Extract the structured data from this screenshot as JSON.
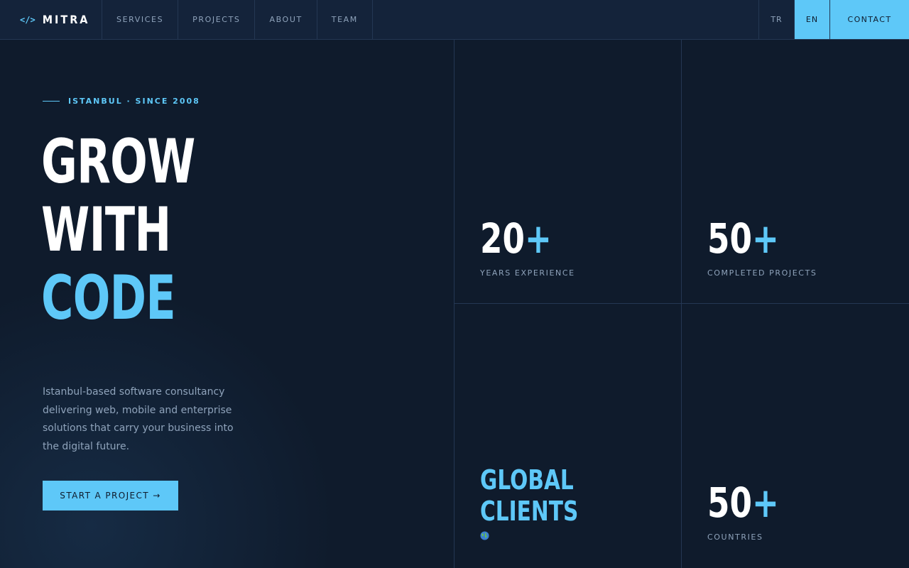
{
  "nav": {
    "brand_icon": "</>",
    "brand": "MITRA",
    "links": [
      "SERVICES",
      "PROJECTS",
      "ABOUT",
      "TEAM"
    ],
    "langs": [
      "TR",
      "EN"
    ],
    "active_lang": "EN",
    "contact": "CONTACT"
  },
  "hero": {
    "eyebrow": "ISTANBUL · SINCE 2008",
    "headline": [
      "GROW",
      "WITH",
      "CODE"
    ],
    "description": "Istanbul-based software consultancy delivering web, mobile and enterprise solutions that carry your business into the digital future.",
    "cta": "START A PROJECT →"
  },
  "stats": [
    {
      "value": "20",
      "suffix": "+",
      "label": "YEARS EXPERIENCE"
    },
    {
      "value": "50",
      "suffix": "+",
      "label": "COMPLETED PROJECTS"
    },
    {
      "title": [
        "GLOBAL",
        "CLIENTS"
      ],
      "icon": "globe-icon"
    },
    {
      "value": "50",
      "suffix": "+",
      "label": "COUNTRIES"
    }
  ],
  "colors": {
    "background": "#0f1b2c",
    "accent": "#5ec8f8",
    "muted_text": "#8fa3bb"
  }
}
